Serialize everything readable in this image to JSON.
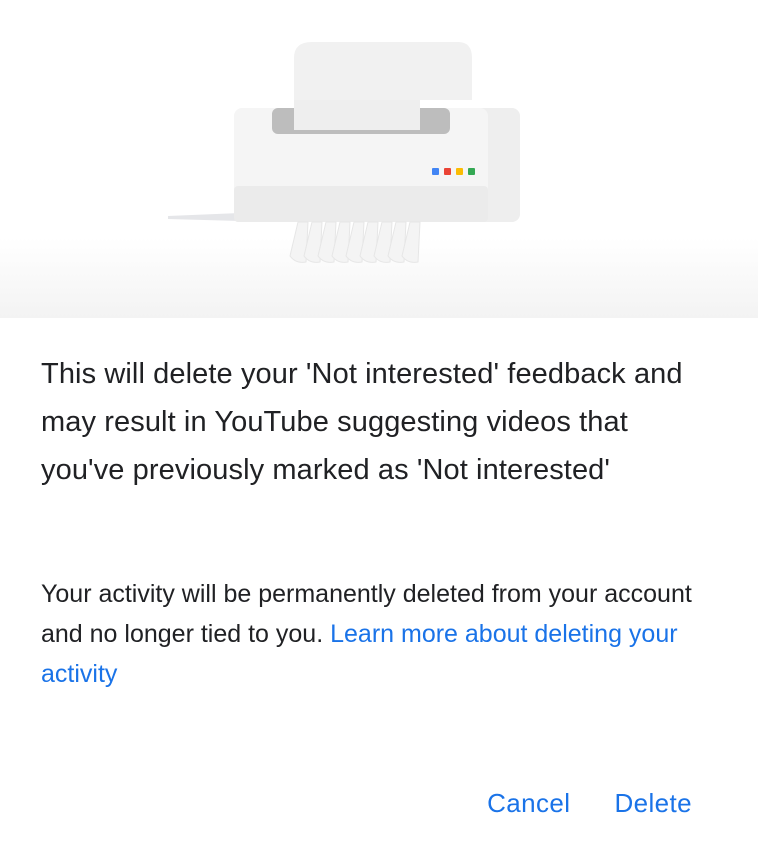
{
  "dialog": {
    "title": "This will delete your 'Not interested' feedback and may result in YouTube suggesting videos that you've previously marked as 'Not interested'",
    "body_text": "Your activity will be permanently deleted from your account and no longer tied to you.",
    "learn_more_link": "Learn more about deleting your activity",
    "illustration": "paper-shredder-illustration",
    "dot_colors": [
      "#4285f4",
      "#ea4335",
      "#fbbc04",
      "#34a853"
    ]
  },
  "actions": {
    "cancel_label": "Cancel",
    "delete_label": "Delete"
  },
  "colors": {
    "accent": "#1a73e8",
    "text": "#202124"
  }
}
